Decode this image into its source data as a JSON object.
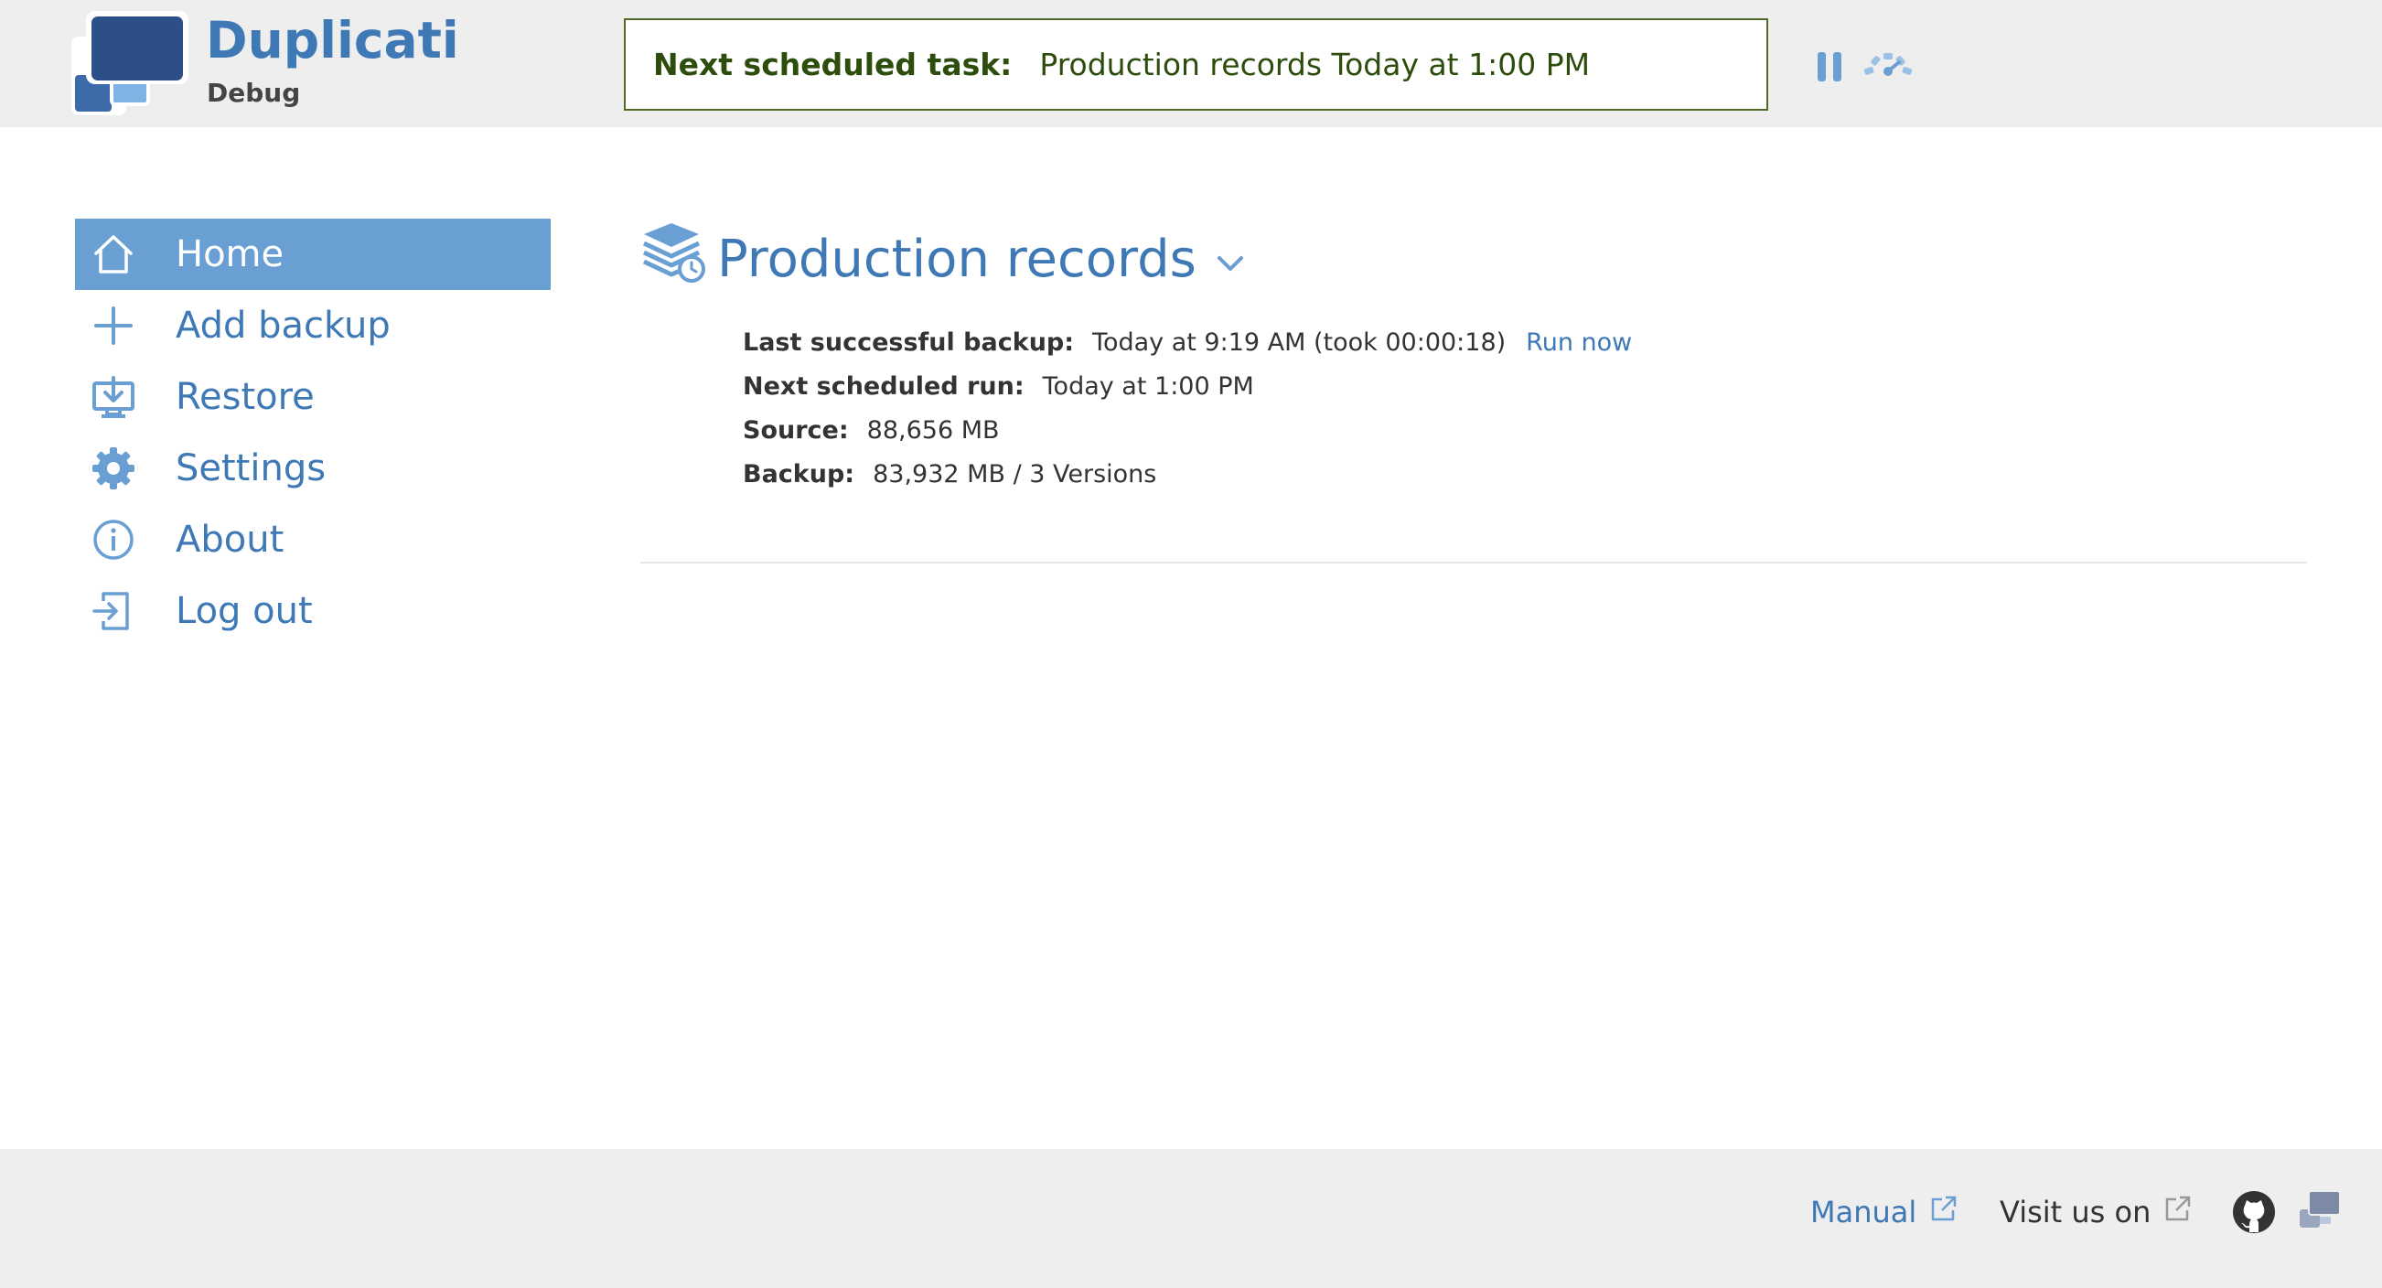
{
  "header": {
    "brand_name": "Duplicati",
    "brand_subtitle": "Debug",
    "scheduled_label": "Next scheduled task:",
    "scheduled_value": "Production records Today at 1:00 PM",
    "pause_icon": "pause-icon",
    "throttle_icon": "throttle-gauge-icon"
  },
  "sidebar": {
    "items": [
      {
        "label": "Home",
        "icon": "home-icon",
        "active": true
      },
      {
        "label": "Add backup",
        "icon": "plus-icon",
        "active": false
      },
      {
        "label": "Restore",
        "icon": "restore-icon",
        "active": false
      },
      {
        "label": "Settings",
        "icon": "gear-icon",
        "active": false
      },
      {
        "label": "About",
        "icon": "info-icon",
        "active": false
      },
      {
        "label": "Log out",
        "icon": "logout-icon",
        "active": false
      }
    ]
  },
  "backup": {
    "title": "Production records",
    "icon": "database-icon",
    "last_backup_label": "Last successful backup:",
    "last_backup_value": "Today at 9:19 AM (took 00:00:18)",
    "run_now": "Run now",
    "next_run_label": "Next scheduled run:",
    "next_run_value": "Today at 1:00 PM",
    "source_label": "Source:",
    "source_value": "88,656 MB",
    "backup_label": "Backup:",
    "backup_value": "83,932 MB / 3 Versions"
  },
  "footer": {
    "manual": "Manual",
    "visit": "Visit us on"
  },
  "colors": {
    "accent": "#3e78b5",
    "active_bg": "#6a9fd4",
    "schedule_text": "#2d4d0c",
    "schedule_border": "#4f6a26",
    "bar_bg": "#eeeeee"
  }
}
